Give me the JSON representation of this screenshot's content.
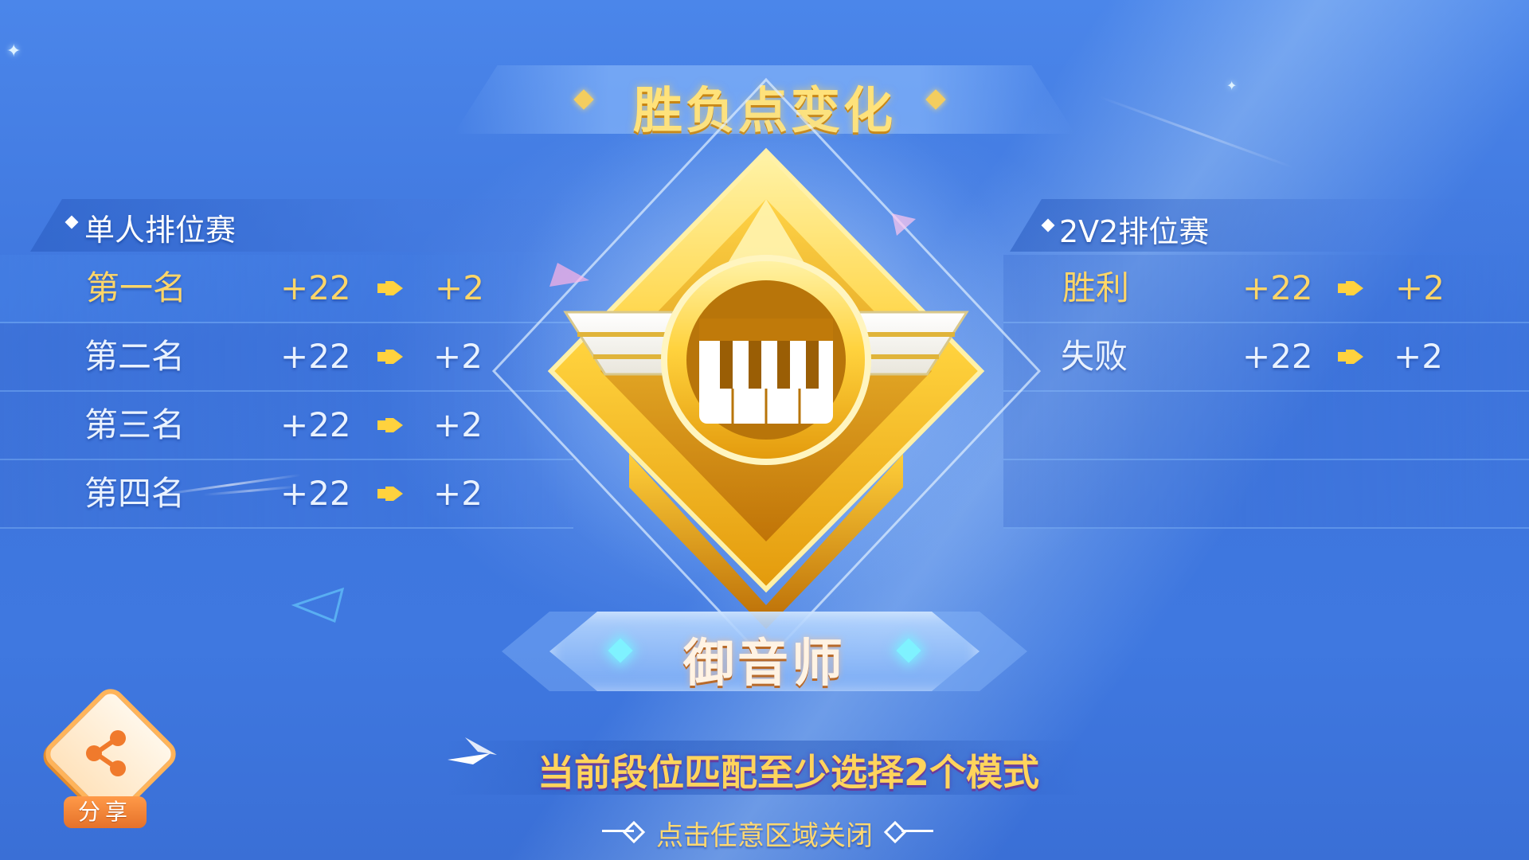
{
  "title": "胜负点变化",
  "solo": {
    "title": "单人排位赛",
    "rows": [
      {
        "label": "第一名",
        "before": "+22",
        "after": "+2"
      },
      {
        "label": "第二名",
        "before": "+22",
        "after": "+2"
      },
      {
        "label": "第三名",
        "before": "+22",
        "after": "+2"
      },
      {
        "label": "第四名",
        "before": "+22",
        "after": "+2"
      }
    ]
  },
  "duo": {
    "title": "2V2排位赛",
    "rows": [
      {
        "label": "胜利",
        "before": "+22",
        "after": "+2"
      },
      {
        "label": "失败",
        "before": "+22",
        "after": "+2"
      }
    ]
  },
  "rank_name": "御音师",
  "tip": "当前段位匹配至少选择2个模式",
  "close_hint": "点击任意区域关闭",
  "share": {
    "label": "分享",
    "icon": "share-icon"
  },
  "badge": {
    "icon": "piano-keys-icon"
  },
  "colors": {
    "gold": "#ffd668",
    "background": "#3f78e0",
    "tip": "#ffd45c"
  }
}
